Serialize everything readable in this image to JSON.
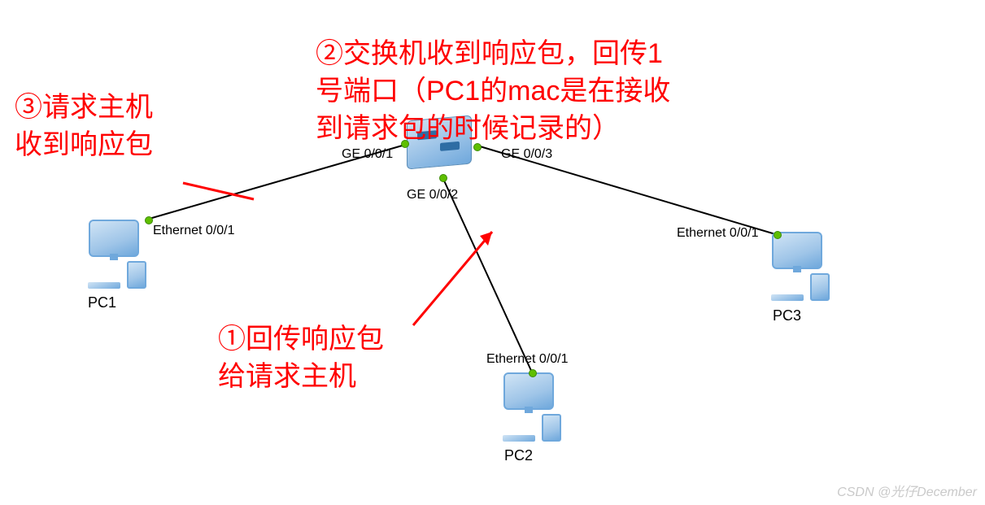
{
  "annotations": {
    "step1": "①回传响应包\n给请求主机",
    "step2": "②交换机收到响应包，回传1\n号端口（PC1的mac是在接收\n到请求包的时候记录的）",
    "step3": "③请求主机\n收到响应包"
  },
  "devices": {
    "pc1": {
      "label": "PC1",
      "port": "Ethernet 0/0/1"
    },
    "pc2": {
      "label": "PC2",
      "port": "Ethernet 0/0/1"
    },
    "pc3": {
      "label": "PC3",
      "port": "Ethernet 0/0/1"
    },
    "switch": {
      "port1": "GE 0/0/1",
      "port2": "GE 0/0/2",
      "port3": "GE 0/0/3"
    }
  },
  "watermark": "CSDN @光仔December"
}
